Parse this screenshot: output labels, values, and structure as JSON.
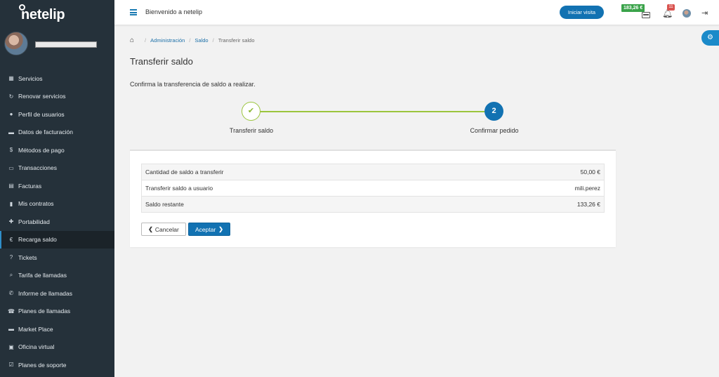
{
  "brand": {
    "name": "netelip"
  },
  "sidebar": {
    "items": [
      {
        "icon": "grid-icon",
        "glyph": "▦",
        "label": "Servicios"
      },
      {
        "icon": "refresh-icon",
        "glyph": "↻",
        "label": "Renovar servicios"
      },
      {
        "icon": "user-icon",
        "glyph": "●",
        "label": "Perfil de usuarios"
      },
      {
        "icon": "building-icon",
        "glyph": "▬",
        "label": "Datos de facturación"
      },
      {
        "icon": "dollar-icon",
        "glyph": "$",
        "label": "Métodos de pago"
      },
      {
        "icon": "card-icon",
        "glyph": "▭",
        "label": "Transacciones"
      },
      {
        "icon": "invoice-icon",
        "glyph": "▤",
        "label": "Facturas"
      },
      {
        "icon": "file-icon",
        "glyph": "▮",
        "label": "Mis contratos"
      },
      {
        "icon": "plus-icon",
        "glyph": "✚",
        "label": "Portabilidad"
      },
      {
        "icon": "euro-icon",
        "glyph": "€",
        "label": "Recarga saldo"
      },
      {
        "icon": "question-icon",
        "glyph": "?",
        "label": "Tickets"
      },
      {
        "icon": "search-icon",
        "glyph": "⌕",
        "label": "Tarifa de llamadas"
      },
      {
        "icon": "phone-icon",
        "glyph": "✆",
        "label": "Informe de llamadas"
      },
      {
        "icon": "phone-desk-icon",
        "glyph": "☎",
        "label": "Planes de llamadas"
      },
      {
        "icon": "store-icon",
        "glyph": "▬",
        "label": "Market Place"
      },
      {
        "icon": "briefcase-icon",
        "glyph": "▣",
        "label": "Oficina virtual"
      },
      {
        "icon": "checkbox-icon",
        "glyph": "☑",
        "label": "Planes de soporte"
      }
    ]
  },
  "header": {
    "welcome": "Bienvenido a netelip",
    "visit_button": "Iniciar visita",
    "balance": "183,26 €",
    "notifications": "11"
  },
  "breadcrumb": {
    "items": [
      "Administración",
      "Saldo"
    ],
    "current": "Transferir saldo"
  },
  "page": {
    "title": "Transferir saldo",
    "subtitle": "Confirma la transferencia de saldo a realizar."
  },
  "stepper": {
    "steps": [
      {
        "label": "Transferir saldo",
        "marker": "✔",
        "state": "completed"
      },
      {
        "label": "Confirmar pedido",
        "marker": "2",
        "state": "active"
      }
    ]
  },
  "summary": {
    "rows": [
      {
        "label": "Cantidad de saldo a transferir",
        "value": "50,00 €"
      },
      {
        "label": "Transferir saldo a usuario",
        "value": "mili.perez"
      },
      {
        "label": "Saldo restante",
        "value": "133,26 €"
      }
    ]
  },
  "actions": {
    "cancel": "Cancelar",
    "accept": "Aceptar"
  },
  "colors": {
    "sidebar_bg": "#25313a",
    "primary": "#1272b2",
    "success": "#9bc53d",
    "balance_badge": "#3aa34a",
    "notif_badge": "#d9534f"
  }
}
